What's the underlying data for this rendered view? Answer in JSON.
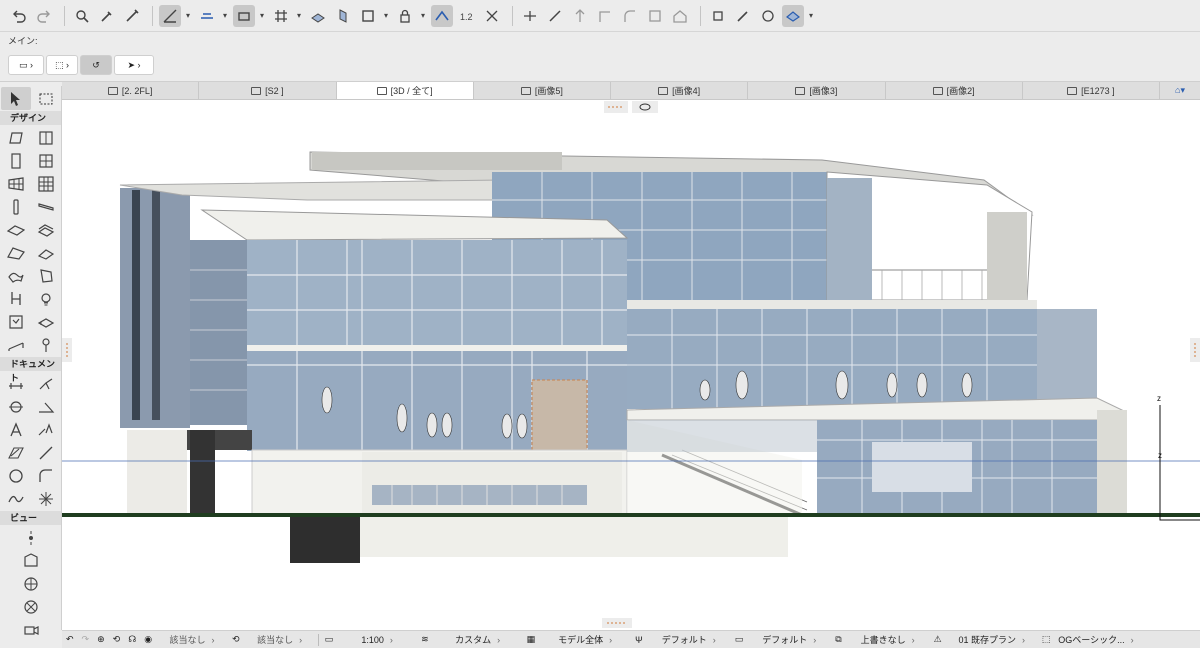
{
  "infobox": {
    "label": "メイン:"
  },
  "tabs": [
    {
      "label": "[2. 2FL]",
      "icon": "floor-plan-icon",
      "active": false
    },
    {
      "label": "[S2 ]",
      "icon": "section-icon",
      "active": false
    },
    {
      "label": "[3D / 全て]",
      "icon": "3d-cube-icon",
      "active": true
    },
    {
      "label": "[画像5]",
      "icon": "camera-icon",
      "active": false
    },
    {
      "label": "[画像4]",
      "icon": "camera-icon",
      "active": false
    },
    {
      "label": "[画像3]",
      "icon": "camera-icon",
      "active": false
    },
    {
      "label": "[画像2]",
      "icon": "camera-icon",
      "active": false
    },
    {
      "label": "[E1273 ]",
      "icon": "elevation-icon",
      "active": false
    }
  ],
  "toolbox": {
    "sections": [
      {
        "title": "デザイン"
      },
      {
        "title": "ドキュメント"
      },
      {
        "title": "ビュー"
      }
    ]
  },
  "statusbar": {
    "items": [
      {
        "label": "該当なし"
      },
      {
        "label": "該当なし"
      },
      {
        "label": "1:100"
      },
      {
        "label": "カスタム"
      },
      {
        "label": "モデル全体"
      },
      {
        "label": "デフォルト"
      },
      {
        "label": "デフォルト"
      },
      {
        "label": "上書きなし"
      },
      {
        "label": "01 既存プラン"
      },
      {
        "label": "OGベーシック..."
      }
    ]
  },
  "canvas": {
    "axis_label_top": "z",
    "axis_label_mid": "z"
  },
  "colors": {
    "accent": "#2a5db0",
    "ground": "#1f3d1f",
    "glass": "#8ea7c0"
  }
}
